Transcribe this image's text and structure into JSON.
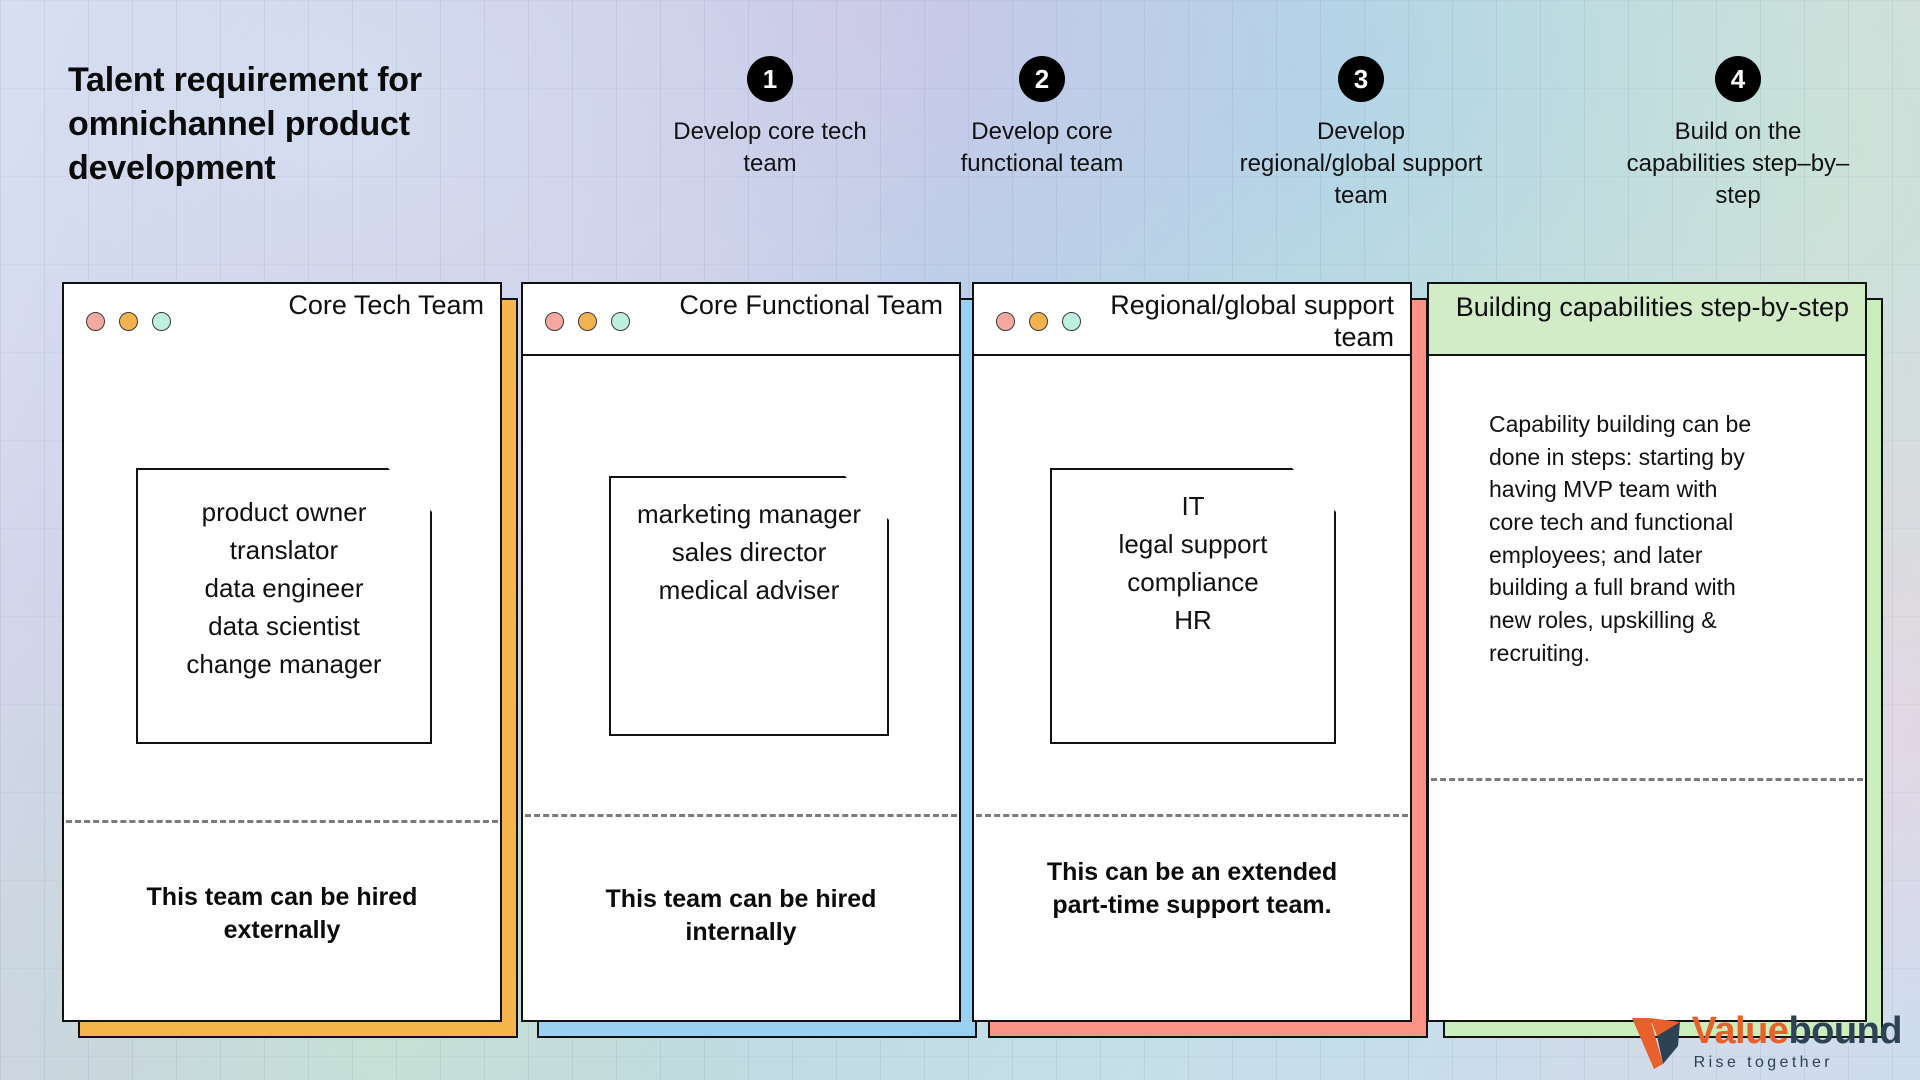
{
  "page": {
    "title": "Talent requirement for omnichannel product development"
  },
  "steps": [
    {
      "number": "1",
      "label": "Develop core tech team"
    },
    {
      "number": "2",
      "label": "Develop core functional team"
    },
    {
      "number": "3",
      "label": "Develop regional/global support team"
    },
    {
      "number": "4",
      "label": "Build on the capabilities step–by–step"
    }
  ],
  "cards": [
    {
      "title": "Core Tech Team",
      "shadow_color": "#f5b54a",
      "header_style": "plain",
      "dots": [
        "#f4a9a0",
        "#f2b24e",
        "#bdf0de"
      ],
      "note_lines": [
        "product owner",
        "translator",
        "data engineer",
        "data scientist",
        "change manager"
      ],
      "footer": "This team can be hired externally"
    },
    {
      "title": "Core Functional Team",
      "shadow_color": "#9bd0f5",
      "header_style": "ruled",
      "dots": [
        "#f4a9a0",
        "#f2b24e",
        "#bdf0de"
      ],
      "note_lines": [
        "marketing manager",
        "sales director",
        "medical adviser"
      ],
      "footer": "This team can be hired internally"
    },
    {
      "title": "Regional/global support team",
      "shadow_color": "#fb9487",
      "header_style": "ruled",
      "dots": [
        "#f4a9a0",
        "#f2b24e",
        "#bdf0de"
      ],
      "note_lines": [
        "IT",
        "legal support",
        "compliance",
        "HR"
      ],
      "footer": "This can be an extended part-time support team."
    },
    {
      "title": "Building capabilities step-by-step",
      "shadow_color": "#cbeebd",
      "header_style": "green",
      "dots": [],
      "body_text": "Capability building can be done in steps: starting by having MVP team with core tech and functional employees; and later building a full brand with new roles, upskilling & recruiting.",
      "footer": ""
    }
  ],
  "logo": {
    "name_part_a": "Value",
    "name_part_b": "bound",
    "tagline": "Rise together",
    "mark_color_outer": "#e8602c",
    "mark_color_inner": "#2e4256"
  }
}
